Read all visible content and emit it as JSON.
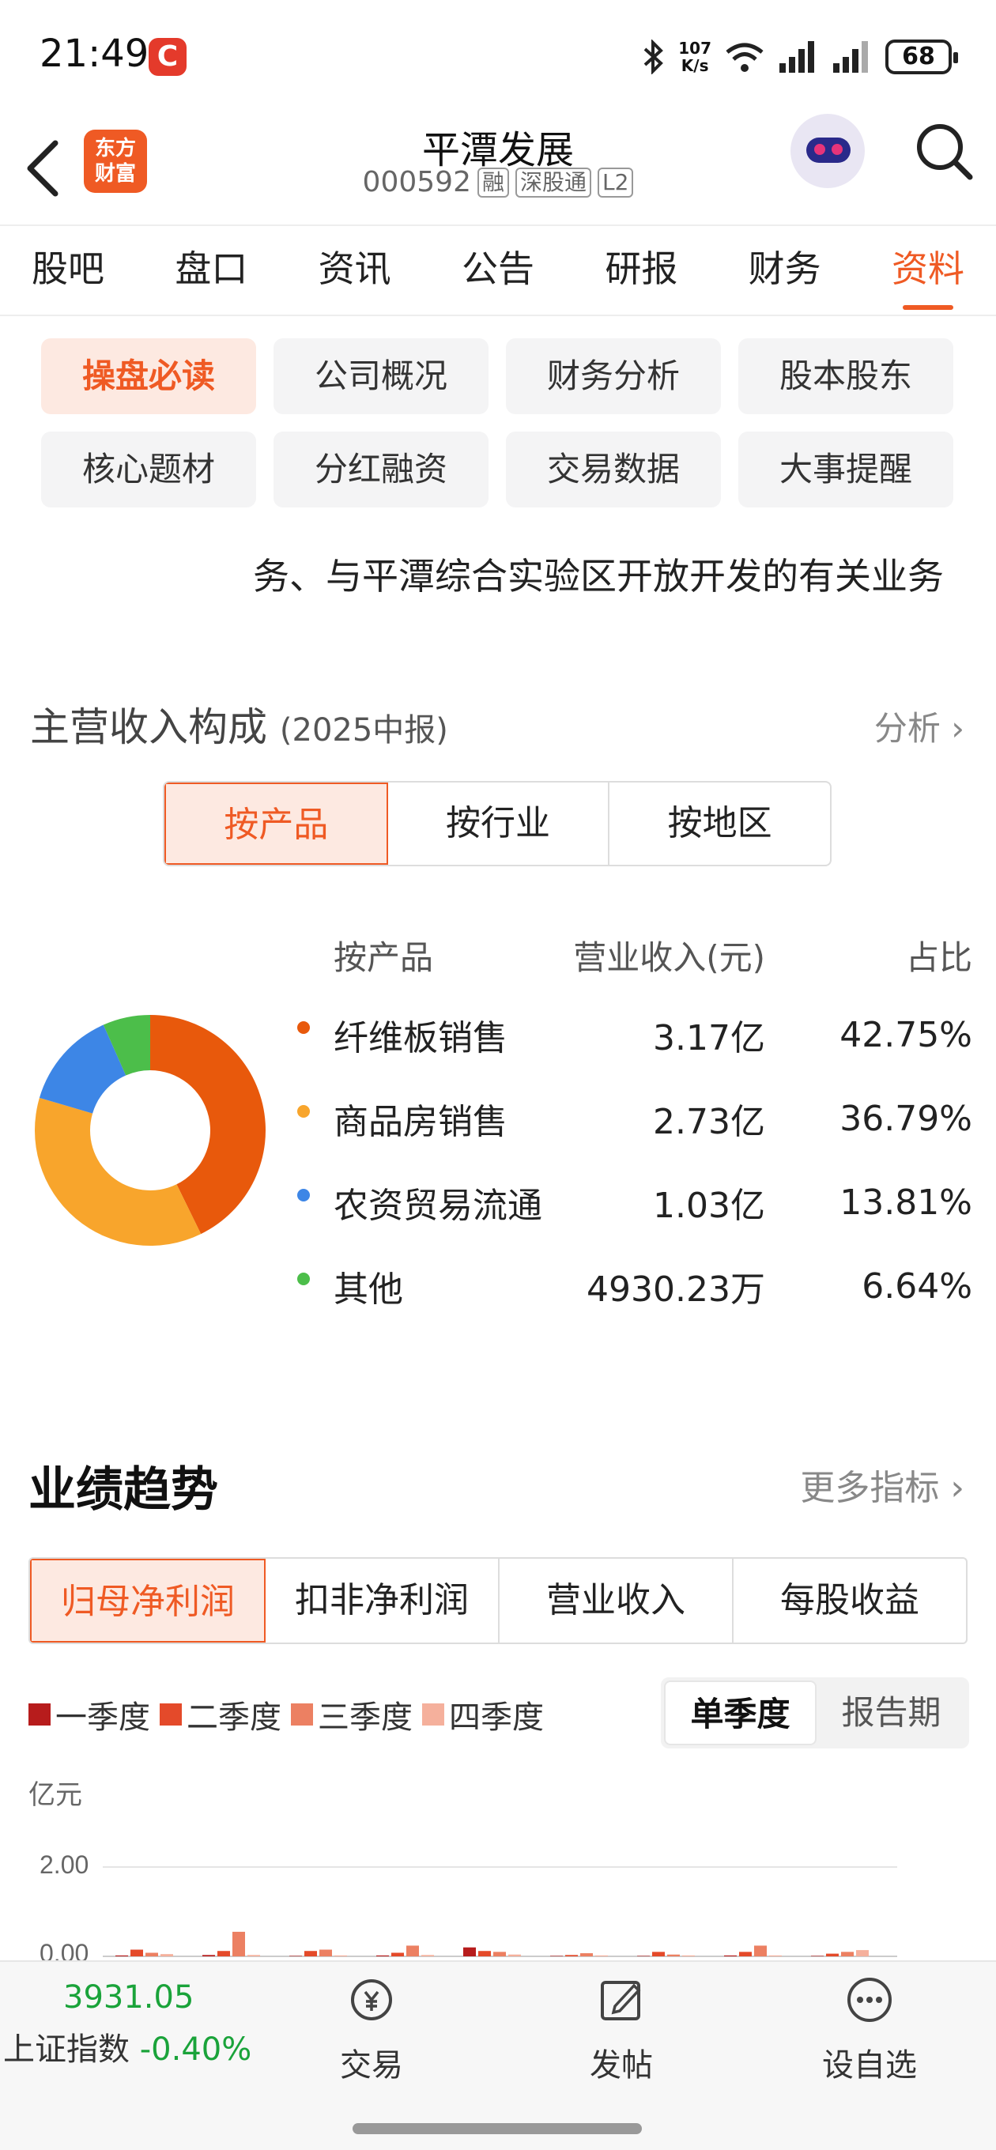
{
  "status_bar": {
    "time": "21:49",
    "app_badge": "C",
    "net_speed_value": "107",
    "net_speed_unit": "K/s",
    "battery": "68"
  },
  "header": {
    "logo_text_1": "东方",
    "logo_text_2": "财富",
    "title": "平潭发展",
    "code": "000592",
    "tags": [
      "融",
      "深股通",
      "L2"
    ]
  },
  "main_tabs": [
    "股吧",
    "盘口",
    "资讯",
    "公告",
    "研报",
    "财务",
    "资料"
  ],
  "main_tabs_active": "资料",
  "subnav": [
    "操盘必读",
    "公司概况",
    "财务分析",
    "股本股东",
    "核心题材",
    "分红融资",
    "交易数据",
    "大事提醒"
  ],
  "business_desc": "务、与平潭综合实验区开放开发的有关业务",
  "revenue": {
    "title": "主营收入构成",
    "period": "(2025中报)",
    "analysis_link": "分析",
    "segments": [
      "按产品",
      "按行业",
      "按地区"
    ],
    "table_headers": [
      "按产品",
      "营业收入(元)",
      "占比"
    ],
    "rows": [
      {
        "name": "纤维板销售",
        "revenue": "3.17亿",
        "ratio": "42.75%",
        "pct": 42.75,
        "color": "#e8590c"
      },
      {
        "name": "商品房销售",
        "revenue": "2.73亿",
        "ratio": "36.79%",
        "pct": 36.79,
        "color": "#f8a52c"
      },
      {
        "name": "农资贸易流通",
        "revenue": "1.03亿",
        "ratio": "13.81%",
        "pct": 13.81,
        "color": "#3d86e6"
      },
      {
        "name": "其他",
        "revenue": "4930.23万",
        "ratio": "6.64%",
        "pct": 6.64,
        "color": "#4cbe4a"
      }
    ]
  },
  "performance": {
    "title": "业绩趋势",
    "more_link": "更多指标",
    "tabs": [
      "归母净利润",
      "扣非净利润",
      "营业收入",
      "每股收益"
    ],
    "legend": [
      {
        "label": "一季度",
        "color": "#b71c1c"
      },
      {
        "label": "二季度",
        "color": "#e44a2a"
      },
      {
        "label": "三季度",
        "color": "#ec8062"
      },
      {
        "label": "四季度",
        "color": "#f5b09c"
      }
    ],
    "period_toggle": [
      "单季度",
      "报告期"
    ],
    "unit": "亿元",
    "ytick_top": "2.00",
    "ytick_zero": "0.00"
  },
  "chart_data": {
    "type": "bar",
    "ylabel": "亿元",
    "ylim": [
      0,
      2.0
    ],
    "series": [
      {
        "name": "一季度",
        "values": [
          0.02,
          0.03,
          0.01,
          0.02,
          0.2,
          0.01,
          0.01,
          0.02,
          0.01
        ]
      },
      {
        "name": "二季度",
        "values": [
          0.15,
          0.12,
          0.12,
          0.08,
          0.12,
          0.03,
          0.1,
          0.1,
          0.06
        ]
      },
      {
        "name": "三季度",
        "values": [
          0.08,
          0.55,
          0.15,
          0.24,
          0.1,
          0.07,
          0.04,
          0.24,
          0.1
        ]
      },
      {
        "name": "四季度",
        "values": [
          0.05,
          0.03,
          0.02,
          0.03,
          0.04,
          0.02,
          0.02,
          0.02,
          0.14
        ]
      }
    ]
  },
  "bottom_bar": {
    "index_value": "3931.05",
    "index_name": "上证指数",
    "index_change": "-0.40%",
    "items": [
      "交易",
      "发帖",
      "设自选"
    ]
  }
}
